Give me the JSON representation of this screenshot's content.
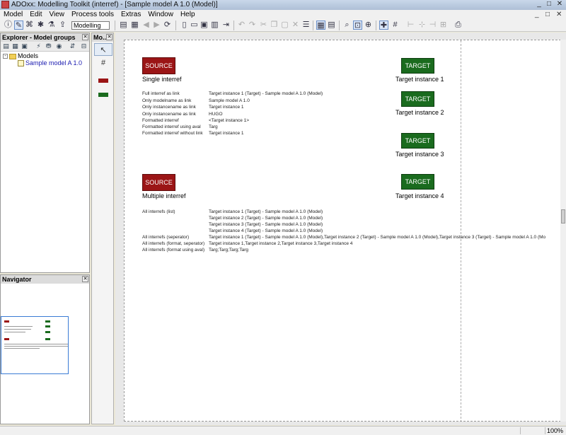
{
  "window": {
    "title": "ADOxx: Modelling Toolkit (interref) - [Sample model A 1.0 (Model)]",
    "controls": [
      "_",
      "□",
      "✕"
    ]
  },
  "menu": [
    "Model",
    "Edit",
    "View",
    "Process tools",
    "Extras",
    "Window",
    "Help"
  ],
  "mdi_controls": [
    "_",
    "□",
    "✕"
  ],
  "toolbar": {
    "mode": "Modelling"
  },
  "explorer": {
    "title": "Explorer - Model groups",
    "tree": {
      "group": "Models",
      "model": "Sample model A 1.0"
    }
  },
  "modelling_bar": {
    "title": "Mo..."
  },
  "navigator": {
    "title": "Navigator"
  },
  "model": {
    "single": {
      "source_label": "SOURCE",
      "caption": "Single interref",
      "rows": [
        {
          "name": "Full interref as link",
          "value": "Target instance 1 (Target) - Sample model A 1.0 (Model)"
        },
        {
          "name": "Only modelname as link",
          "value": "Sample model A 1.0"
        },
        {
          "name": "Only instancename as link",
          "value": "Target instance 1"
        },
        {
          "name": "Only instancename as link",
          "value": "HUGO"
        },
        {
          "name": "Formatted interref",
          "value": "<Target instance 1>"
        },
        {
          "name": "Formatted interref using aval",
          "value": "Targ"
        },
        {
          "name": "Formatted interref without link",
          "value": "Target instance 1"
        }
      ]
    },
    "multiple": {
      "source_label": "SOURCE",
      "caption": "Multiple interref",
      "rows": [
        {
          "name": "All interrefs (list)",
          "value": "Target instance 1 (Target) - Sample model A 1.0 (Model)"
        },
        {
          "name": "",
          "value": "Target instance 2 (Target) - Sample model A 1.0 (Model)"
        },
        {
          "name": "",
          "value": "Target instance 3 (Target) - Sample model A 1.0 (Model)"
        },
        {
          "name": "",
          "value": "Target instance 4 (Target) - Sample model A 1.0 (Model)"
        },
        {
          "name": "All interrefs (seperator)",
          "value": "Target instance 1 (Target) - Sample model A 1.0 (Model),Target instance 2 (Target) - Sample model A 1.0 (Model),Target instance 3 (Target) - Sample model A 1.0 (Mo"
        },
        {
          "name": "All interrefs (format, seperator)",
          "value": "Target instance 1,Target instance 2,Target instance 3,Target instance 4"
        },
        {
          "name": "All interrefs (format using aval)",
          "value": "Targ;Targ;Targ;Targ"
        }
      ]
    },
    "targets": [
      {
        "label": "TARGET",
        "caption": "Target instance 1"
      },
      {
        "label": "TARGET",
        "caption": "Target instance 2"
      },
      {
        "label": "TARGET",
        "caption": "Target instance 3"
      },
      {
        "label": "TARGET",
        "caption": "Target instance 4"
      }
    ]
  },
  "status": {
    "zoom": "100%"
  },
  "colors": {
    "source": "#9b1516",
    "target": "#1a6b1e",
    "selection": "#3a7bd5"
  }
}
